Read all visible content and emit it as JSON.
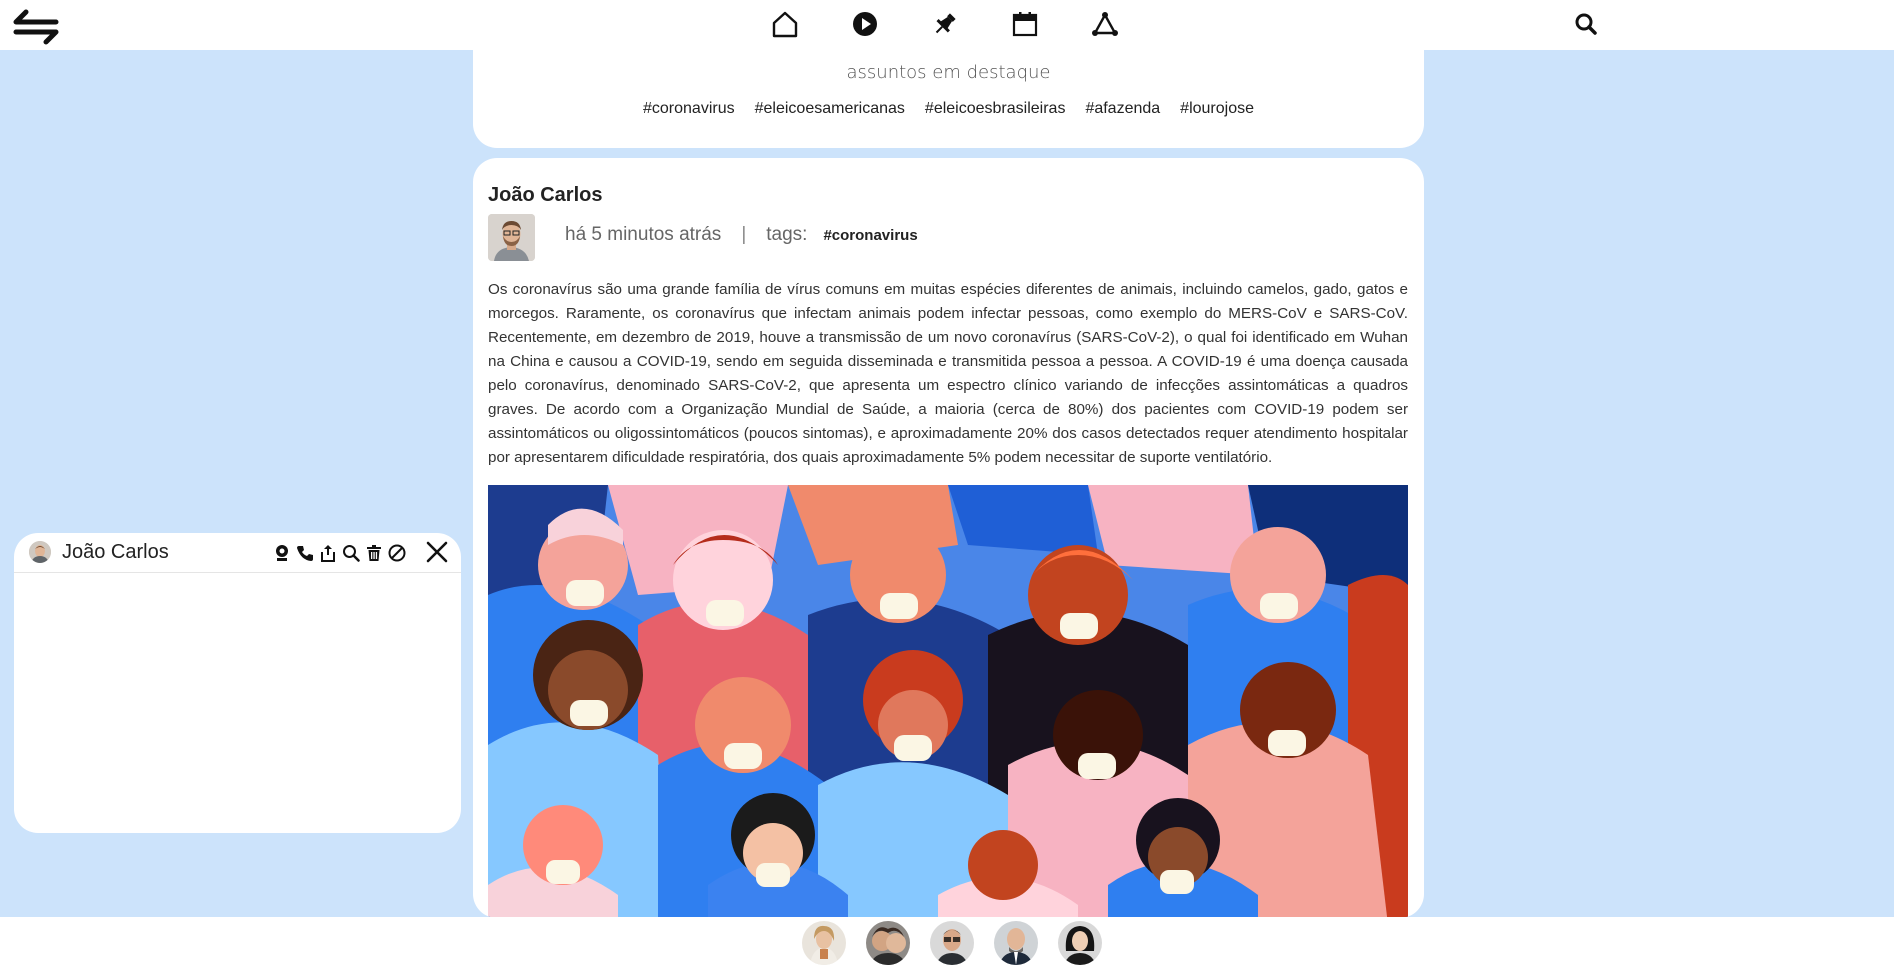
{
  "header": {
    "logo_icon": "swap-arrows-icon",
    "nav": [
      {
        "name": "home",
        "icon": "home-icon"
      },
      {
        "name": "videos",
        "icon": "play-icon"
      },
      {
        "name": "pinned",
        "icon": "pin-icon"
      },
      {
        "name": "events",
        "icon": "calendar-icon"
      },
      {
        "name": "network",
        "icon": "network-icon"
      }
    ],
    "search_icon": "search-icon"
  },
  "trending": {
    "title": "assuntos em destaque",
    "tags": [
      "#coronavirus",
      "#eleicoesamericanas",
      "#eleicoesbrasileiras",
      "#afazenda",
      "#lourojose"
    ]
  },
  "post": {
    "author": "João Carlos",
    "time": "há 5 minutos atrás",
    "separator": "|",
    "tags_label": "tags:",
    "tag": "#coronavirus",
    "text": "Os coronavírus são uma grande família de vírus comuns em muitas espécies diferentes de animais, incluindo camelos, gado, gatos e morcegos. Raramente, os coronavírus que infectam animais podem infectar pessoas, como exemplo do MERS-CoV e SARS-CoV. Recentemente, em dezembro de 2019, houve a transmissão de um novo coronavírus (SARS-CoV-2), o qual foi identificado em Wuhan na China e causou a COVID-19, sendo em seguida disseminada e transmitida pessoa a pessoa. A COVID-19 é uma doença causada pelo coronavírus, denominado SARS-CoV-2, que apresenta um espectro clínico variando de infecções assintomáticas a quadros graves. De acordo com a Organização Mundial de Saúde, a maioria (cerca de 80%) dos pacientes com COVID-19 podem ser assintomáticos ou oligossintomáticos (poucos sintomas), e aproximadamente 20% dos casos detectados requer atendimento hospitalar por apresentarem dificuldade respiratória, dos quais aproximadamente 5% podem necessitar de suporte ventilatório."
  },
  "chat": {
    "name": "João Carlos",
    "tools": [
      "webcam-icon",
      "phone-icon",
      "share-icon",
      "search-icon",
      "trash-icon",
      "block-icon"
    ],
    "close_icon": "close-icon"
  },
  "contacts": [
    "contact-1",
    "contact-2",
    "contact-3",
    "contact-4",
    "contact-5"
  ],
  "colors": {
    "background": "#cce3fb",
    "card": "#ffffff"
  }
}
